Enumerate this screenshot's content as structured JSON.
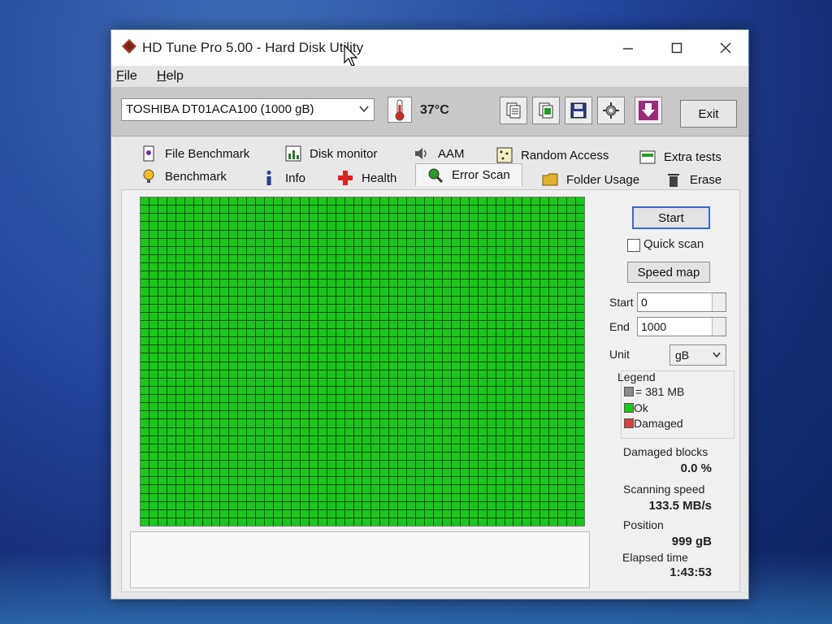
{
  "window": {
    "title": "HD Tune Pro 5.00 - Hard Disk Utility"
  },
  "menu": [
    {
      "hotkey": "F",
      "rest": "ile"
    },
    {
      "hotkey": "H",
      "rest": "elp"
    }
  ],
  "toolbar": {
    "drive": "TOSHIBA DT01ACA100 (1000 gB)",
    "temperature": "37°C",
    "exit_label": "Exit"
  },
  "tabs": {
    "row1": [
      "File Benchmark",
      "Disk monitor",
      "AAM",
      "Random Access",
      "Extra tests"
    ],
    "row2": [
      "Benchmark",
      "Info",
      "Health",
      "Error Scan",
      "Folder Usage",
      "Erase"
    ],
    "active": "Error Scan"
  },
  "scan": {
    "start_button": "Start",
    "quick_scan_label": "Quick scan",
    "quick_scan_checked": false,
    "speed_map_button": "Speed map",
    "start_label": "Start",
    "start_value": "0",
    "end_label": "End",
    "end_value": "1000",
    "unit_label": "Unit",
    "unit_value": "gB"
  },
  "legend": {
    "title": "Legend",
    "block_size": "= 381 MB",
    "ok": "Ok",
    "damaged": "Damaged"
  },
  "stats": {
    "damaged_blocks_label": "Damaged blocks",
    "damaged_blocks_value": "0.0 %",
    "scanning_speed_label": "Scanning speed",
    "scanning_speed_value": "133.5 MB/s",
    "position_label": "Position",
    "position_value": "999 gB",
    "elapsed_label": "Elapsed time",
    "elapsed_value": "1:43:53"
  },
  "colors": {
    "ok_block": "#19c61b",
    "damaged_block": "#d94040",
    "block_border": "#1a4a1a",
    "focus_border": "#3c66c8"
  },
  "icons": [
    "app-icon",
    "thermometer-icon",
    "copy-info-icon",
    "copy-screen-icon",
    "save-icon",
    "options-icon",
    "download-icon",
    "minimize-icon",
    "maximize-icon",
    "close-icon"
  ]
}
